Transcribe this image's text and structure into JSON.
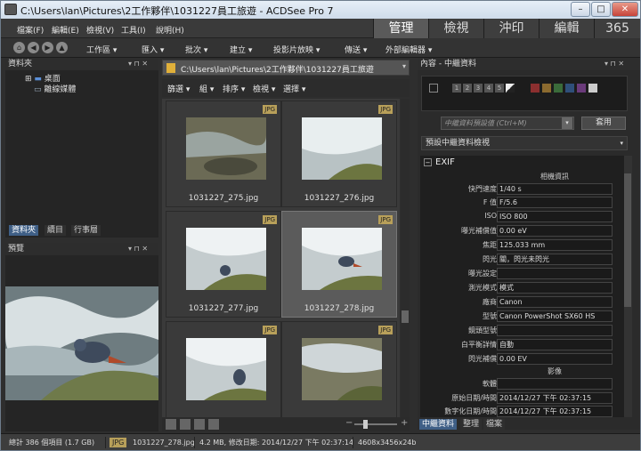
{
  "window": {
    "title": "C:\\Users\\lan\\Pictures\\2工作夥伴\\1031227員工旅遊 - ACDSee Pro 7",
    "btn_min": "–",
    "btn_max": "□",
    "btn_close": "✕"
  },
  "menu": [
    "檔案(F)",
    "編輯(E)",
    "檢視(V)",
    "工具(I)",
    "說明(H)"
  ],
  "toolbar": [
    "工作區",
    "匯入",
    "批次",
    "建立",
    "投影片放映",
    "傳送",
    "外部編輯器"
  ],
  "modes": {
    "items": [
      "管理",
      "檢視",
      "沖印",
      "編輯",
      "365"
    ],
    "active": "管理"
  },
  "folders": {
    "title": "資料夾",
    "items": [
      "桌面",
      "離線媒體"
    ],
    "tabs": [
      "資料夾",
      "續目",
      "行事層"
    ]
  },
  "preview": {
    "title": "預覽"
  },
  "browser": {
    "path": "C:\\Users\\lan\\Pictures\\2工作夥伴\\1031227員工旅遊",
    "filters": [
      "篩選",
      "組",
      "排序",
      "檢視",
      "選擇"
    ],
    "files": [
      {
        "name": "1031227_275.jpg",
        "badge": "JPG"
      },
      {
        "name": "1031227_276.jpg",
        "badge": "JPG"
      },
      {
        "name": "1031227_277.jpg",
        "badge": "JPG"
      },
      {
        "name": "1031227_278.jpg",
        "badge": "JPG"
      },
      {
        "name": "",
        "badge": "JPG"
      },
      {
        "name": "",
        "badge": "JPG"
      }
    ],
    "selected_index": 3
  },
  "properties": {
    "title": "內容 - 中繼資料",
    "ratings": [
      "1",
      "2",
      "3",
      "4",
      "5"
    ],
    "preset_placeholder": "中繼資料預設值 (Ctrl+M)",
    "apply": "套用",
    "view": "預設中繼資料檢視",
    "section": "EXIF",
    "rows": [
      [
        "",
        "相機資訊"
      ],
      [
        "快門速度",
        "1/40 s"
      ],
      [
        "F 值",
        "F/5.6"
      ],
      [
        "ISO",
        "ISO 800"
      ],
      [
        "曝光補償值",
        "0.00 eV"
      ],
      [
        "焦距",
        "125.033 mm"
      ],
      [
        "閃光",
        "關，閃光未閃光"
      ],
      [
        "曝光設定",
        ""
      ],
      [
        "測光模式",
        "模式"
      ],
      [
        "廠商",
        "Canon"
      ],
      [
        "型號",
        "Canon PowerShot SX60 HS"
      ],
      [
        "鏡頭型號",
        ""
      ],
      [
        "白平衡詳情",
        "自動"
      ],
      [
        "閃光補償",
        "0.00 EV"
      ],
      [
        "",
        "影像"
      ],
      [
        "軟體",
        ""
      ],
      [
        "原始日期/時間",
        "2014/12/27 下午 02:37:15"
      ],
      [
        "數字化日期/時間",
        "2014/12/27 下午 02:37:15"
      ]
    ],
    "tabs": [
      "中繼資料",
      "整理",
      "檔案"
    ]
  },
  "status": {
    "total": "總計 386 個項目 (1.7 GB)",
    "type": "JPG",
    "file": "1031227_278.jpg",
    "info": "4.2 MB, 修改日期: 2014/12/27 下午 02:37:14",
    "dims": "4608x3456x24b"
  },
  "colors": {
    "accent": "#3f5f86",
    "label_colors": [
      "#8b2f2f",
      "#8b6a2f",
      "#3a6b3a",
      "#2f4f7a",
      "#6a3a7a",
      "#cccccc"
    ]
  }
}
